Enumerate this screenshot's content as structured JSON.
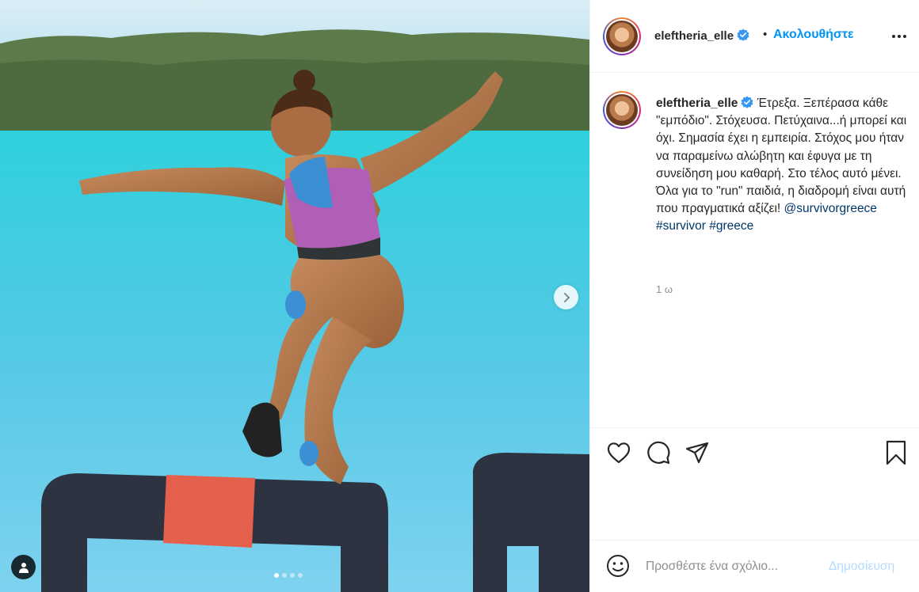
{
  "media": {
    "carousel_count": 4,
    "carousel_active_index": 1
  },
  "header": {
    "username": "eleftheria_elle",
    "bullet": "•",
    "follow_label": "Ακολουθήστε"
  },
  "caption": {
    "username": "eleftheria_elle",
    "text": "Έτρεξα. Ξεπέρασα κάθε \"εμπόδιο\". Στόχευσα. Πετύχαινα...ή μπορεί και όχι. Σημασία έχει η εμπειρία. Στόχος μου ήταν να παραμείνω αλώβητη και έφυγα με τη συνείδηση μου καθαρή. Στο τέλος αυτό μένει. Όλα για το \"run\" παιδιά, η διαδρομή είναι αυτή που πραγματικά αξίζει! ",
    "mention": "@survivorgreece",
    "hashtag1": "#survivor",
    "hashtag2": "#greece",
    "time": "1 ω"
  },
  "comment": {
    "placeholder": "Προσθέστε ένα σχόλιο...",
    "post_label": "Δημοσίευση"
  },
  "colors": {
    "accent": "#0095f6",
    "link": "#00376b",
    "muted": "#8e8e8e",
    "verified": "#3897f0",
    "post_disabled": "#b3dbff"
  },
  "icons": [
    "chevron-right-icon",
    "user-tag-icon",
    "verified-badge-icon",
    "more-options-icon",
    "heart-icon",
    "comment-icon",
    "share-icon",
    "bookmark-icon",
    "emoji-icon"
  ]
}
